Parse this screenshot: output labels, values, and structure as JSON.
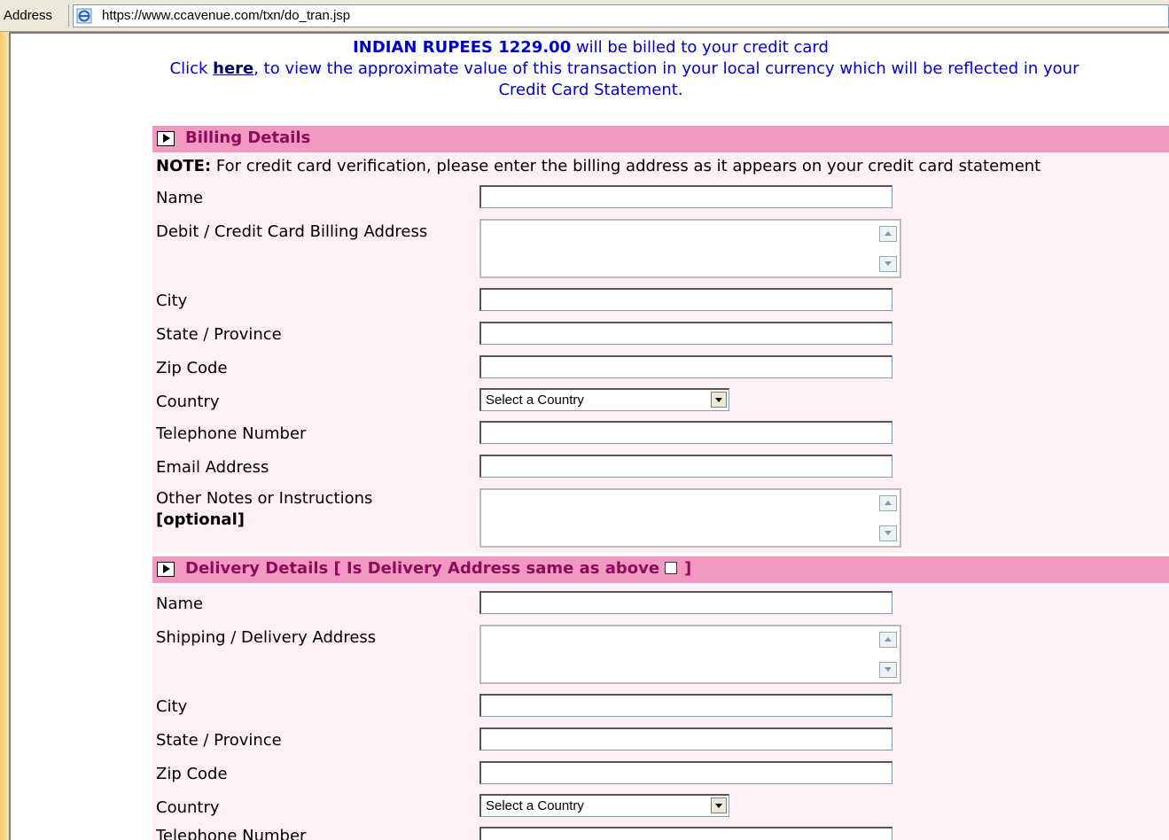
{
  "browser": {
    "address_label": "Address",
    "url": "https://www.ccavenue.com/txn/do_tran.jsp"
  },
  "header": {
    "amount": "INDIAN RUPEES 1229.00",
    "billed_text": " will be billed to your credit card",
    "click_text": "Click ",
    "here_link": "here",
    "view_text": ", to view the approximate value of this transaction in your local currency which will be reflected in your",
    "statement_text": "Credit Card Statement."
  },
  "billing": {
    "title": "Billing Details",
    "note_label": "NOTE:",
    "note_text": " For credit card verification, please enter the billing address as it appears on your credit card statement",
    "name_label": "Name",
    "address_label": "Debit / Credit Card Billing Address",
    "city_label": "City",
    "state_label": "State / Province",
    "zip_label": "Zip Code",
    "country_label": "Country",
    "country_value": "Select a Country",
    "phone_label": "Telephone Number",
    "email_label": "Email Address",
    "notes_label": "Other Notes or Instructions",
    "notes_optional": "[optional]"
  },
  "delivery": {
    "title": "Delivery Details [ Is Delivery Address same as above",
    "title_end": "]",
    "name_label": "Name",
    "address_label": "Shipping / Delivery Address",
    "city_label": "City",
    "state_label": "State / Province",
    "zip_label": "Zip Code",
    "country_label": "Country",
    "country_value": "Select a Country",
    "phone_label": "Telephone Number"
  },
  "colors": {
    "section_header_bg": "#f299c1",
    "section_header_text": "#8b0c5f",
    "row_bg": "#fff0f6",
    "header_text": "#0000cc"
  }
}
